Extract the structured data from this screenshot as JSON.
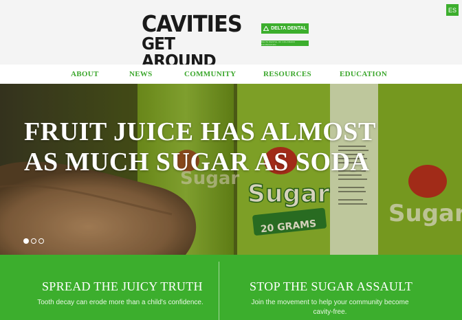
{
  "header": {
    "logo": {
      "line1": "CAVITIES",
      "line2": "GET AROUND"
    },
    "sponsor": {
      "label": "DELTA DENTAL",
      "sub_label": "DELTA DENTAL OF COLORADO FOUNDATION",
      "icon": "delta-triangle-icon"
    },
    "language_button": "ES"
  },
  "nav": {
    "items": [
      {
        "label": "ABOUT"
      },
      {
        "label": "NEWS"
      },
      {
        "label": "COMMUNITY"
      },
      {
        "label": "RESOURCES"
      },
      {
        "label": "EDUCATION"
      }
    ]
  },
  "hero": {
    "title_line1": "FRUIT JUICE HAS ALMOST",
    "title_line2": "AS MUCH SUGAR AS SODA",
    "carton_text": {
      "brand": "Sugar",
      "grams": "20 GRAMS"
    },
    "carousel": {
      "count": 3,
      "active_index": 0
    }
  },
  "promos": [
    {
      "title": "SPREAD THE JUICY TRUTH",
      "text": "Tooth decay can erode more than a child's confidence."
    },
    {
      "title": "STOP THE SUGAR ASSAULT",
      "text_line1": "Join the movement to help your community become",
      "text_line2": "cavity-free."
    }
  ],
  "colors": {
    "brand_green": "#3cae2d",
    "nav_green": "#3aa62b",
    "header_bg": "#f4f4f4"
  }
}
